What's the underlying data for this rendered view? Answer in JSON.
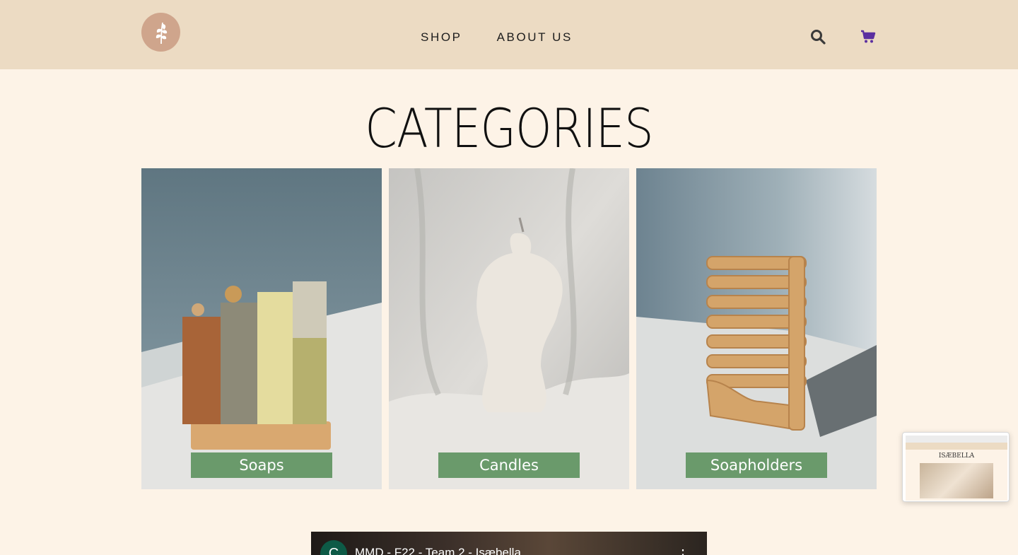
{
  "header": {
    "logo_icon": "leaf-icon",
    "nav": [
      {
        "label": "SHOP"
      },
      {
        "label": "ABOUT US"
      }
    ],
    "search_icon": "search-icon",
    "cart_icon": "cart-icon",
    "colors": {
      "header_bg": "#ecdbc3",
      "logo_bg": "#cfa58c",
      "cart": "#5b2fa0"
    }
  },
  "main": {
    "title": "CATEGORIES",
    "categories": [
      {
        "label": "Soaps"
      },
      {
        "label": "Candles"
      },
      {
        "label": "Soapholders"
      }
    ],
    "label_color": "#6a9a6b"
  },
  "preview_thumbnail": {
    "title": "ISÆBELLA"
  },
  "video": {
    "channel_initial": "C",
    "title": "MMD - F22 - Team 2 - Isæbella",
    "more_icon": "more-vertical-icon"
  }
}
